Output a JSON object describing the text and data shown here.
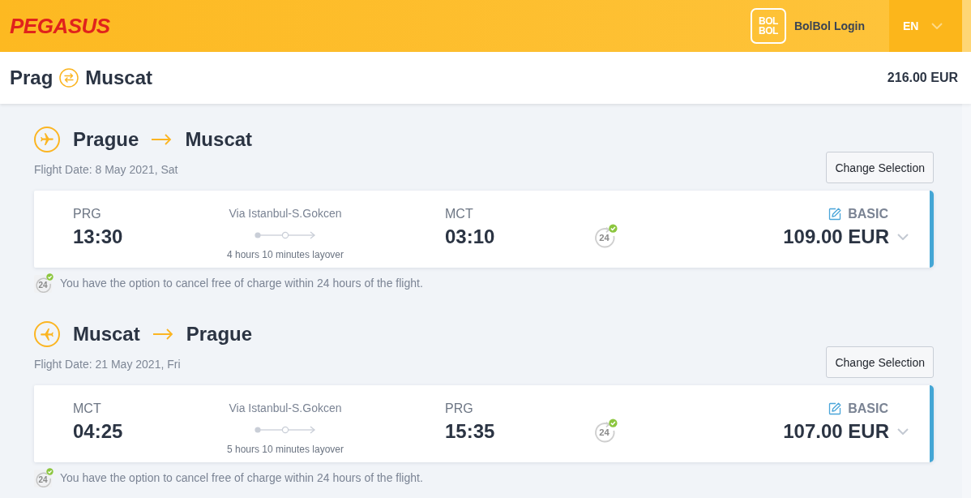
{
  "header": {
    "logo": "PEGASUS",
    "bolbol_logo": [
      "BOL",
      "BOL"
    ],
    "login": "BolBol Login",
    "language": "EN"
  },
  "trip": {
    "origin": "Prag",
    "destination": "Muscat",
    "total": "216.00 EUR"
  },
  "legs": [
    {
      "kind": "outbound",
      "from": "Prague",
      "to": "Muscat",
      "date": "Flight Date: 8 May 2021, Sat",
      "change_button": "Change Selection",
      "departure": {
        "code": "PRG",
        "time": "13:30"
      },
      "via": "Via Istanbul-S.Gokcen",
      "layover": "4 hours 10 minutes layover",
      "arrival": {
        "code": "MCT",
        "time": "03:10"
      },
      "cancel_badge": "24",
      "fare": "BASIC",
      "price": "109.00 EUR",
      "note_badge": "24",
      "note": "You have the option to cancel free of charge within 24 hours of the flight."
    },
    {
      "kind": "inbound",
      "from": "Muscat",
      "to": "Prague",
      "date": "Flight Date: 21 May 2021, Fri",
      "change_button": "Change Selection",
      "departure": {
        "code": "MCT",
        "time": "04:25"
      },
      "via": "Via Istanbul-S.Gokcen",
      "layover": "5 hours 10 minutes layover",
      "arrival": {
        "code": "PRG",
        "time": "15:35"
      },
      "cancel_badge": "24",
      "fare": "BASIC",
      "price": "107.00 EUR",
      "note_badge": "24",
      "note": "You have the option to cancel free of charge within 24 hours of the flight."
    }
  ]
}
